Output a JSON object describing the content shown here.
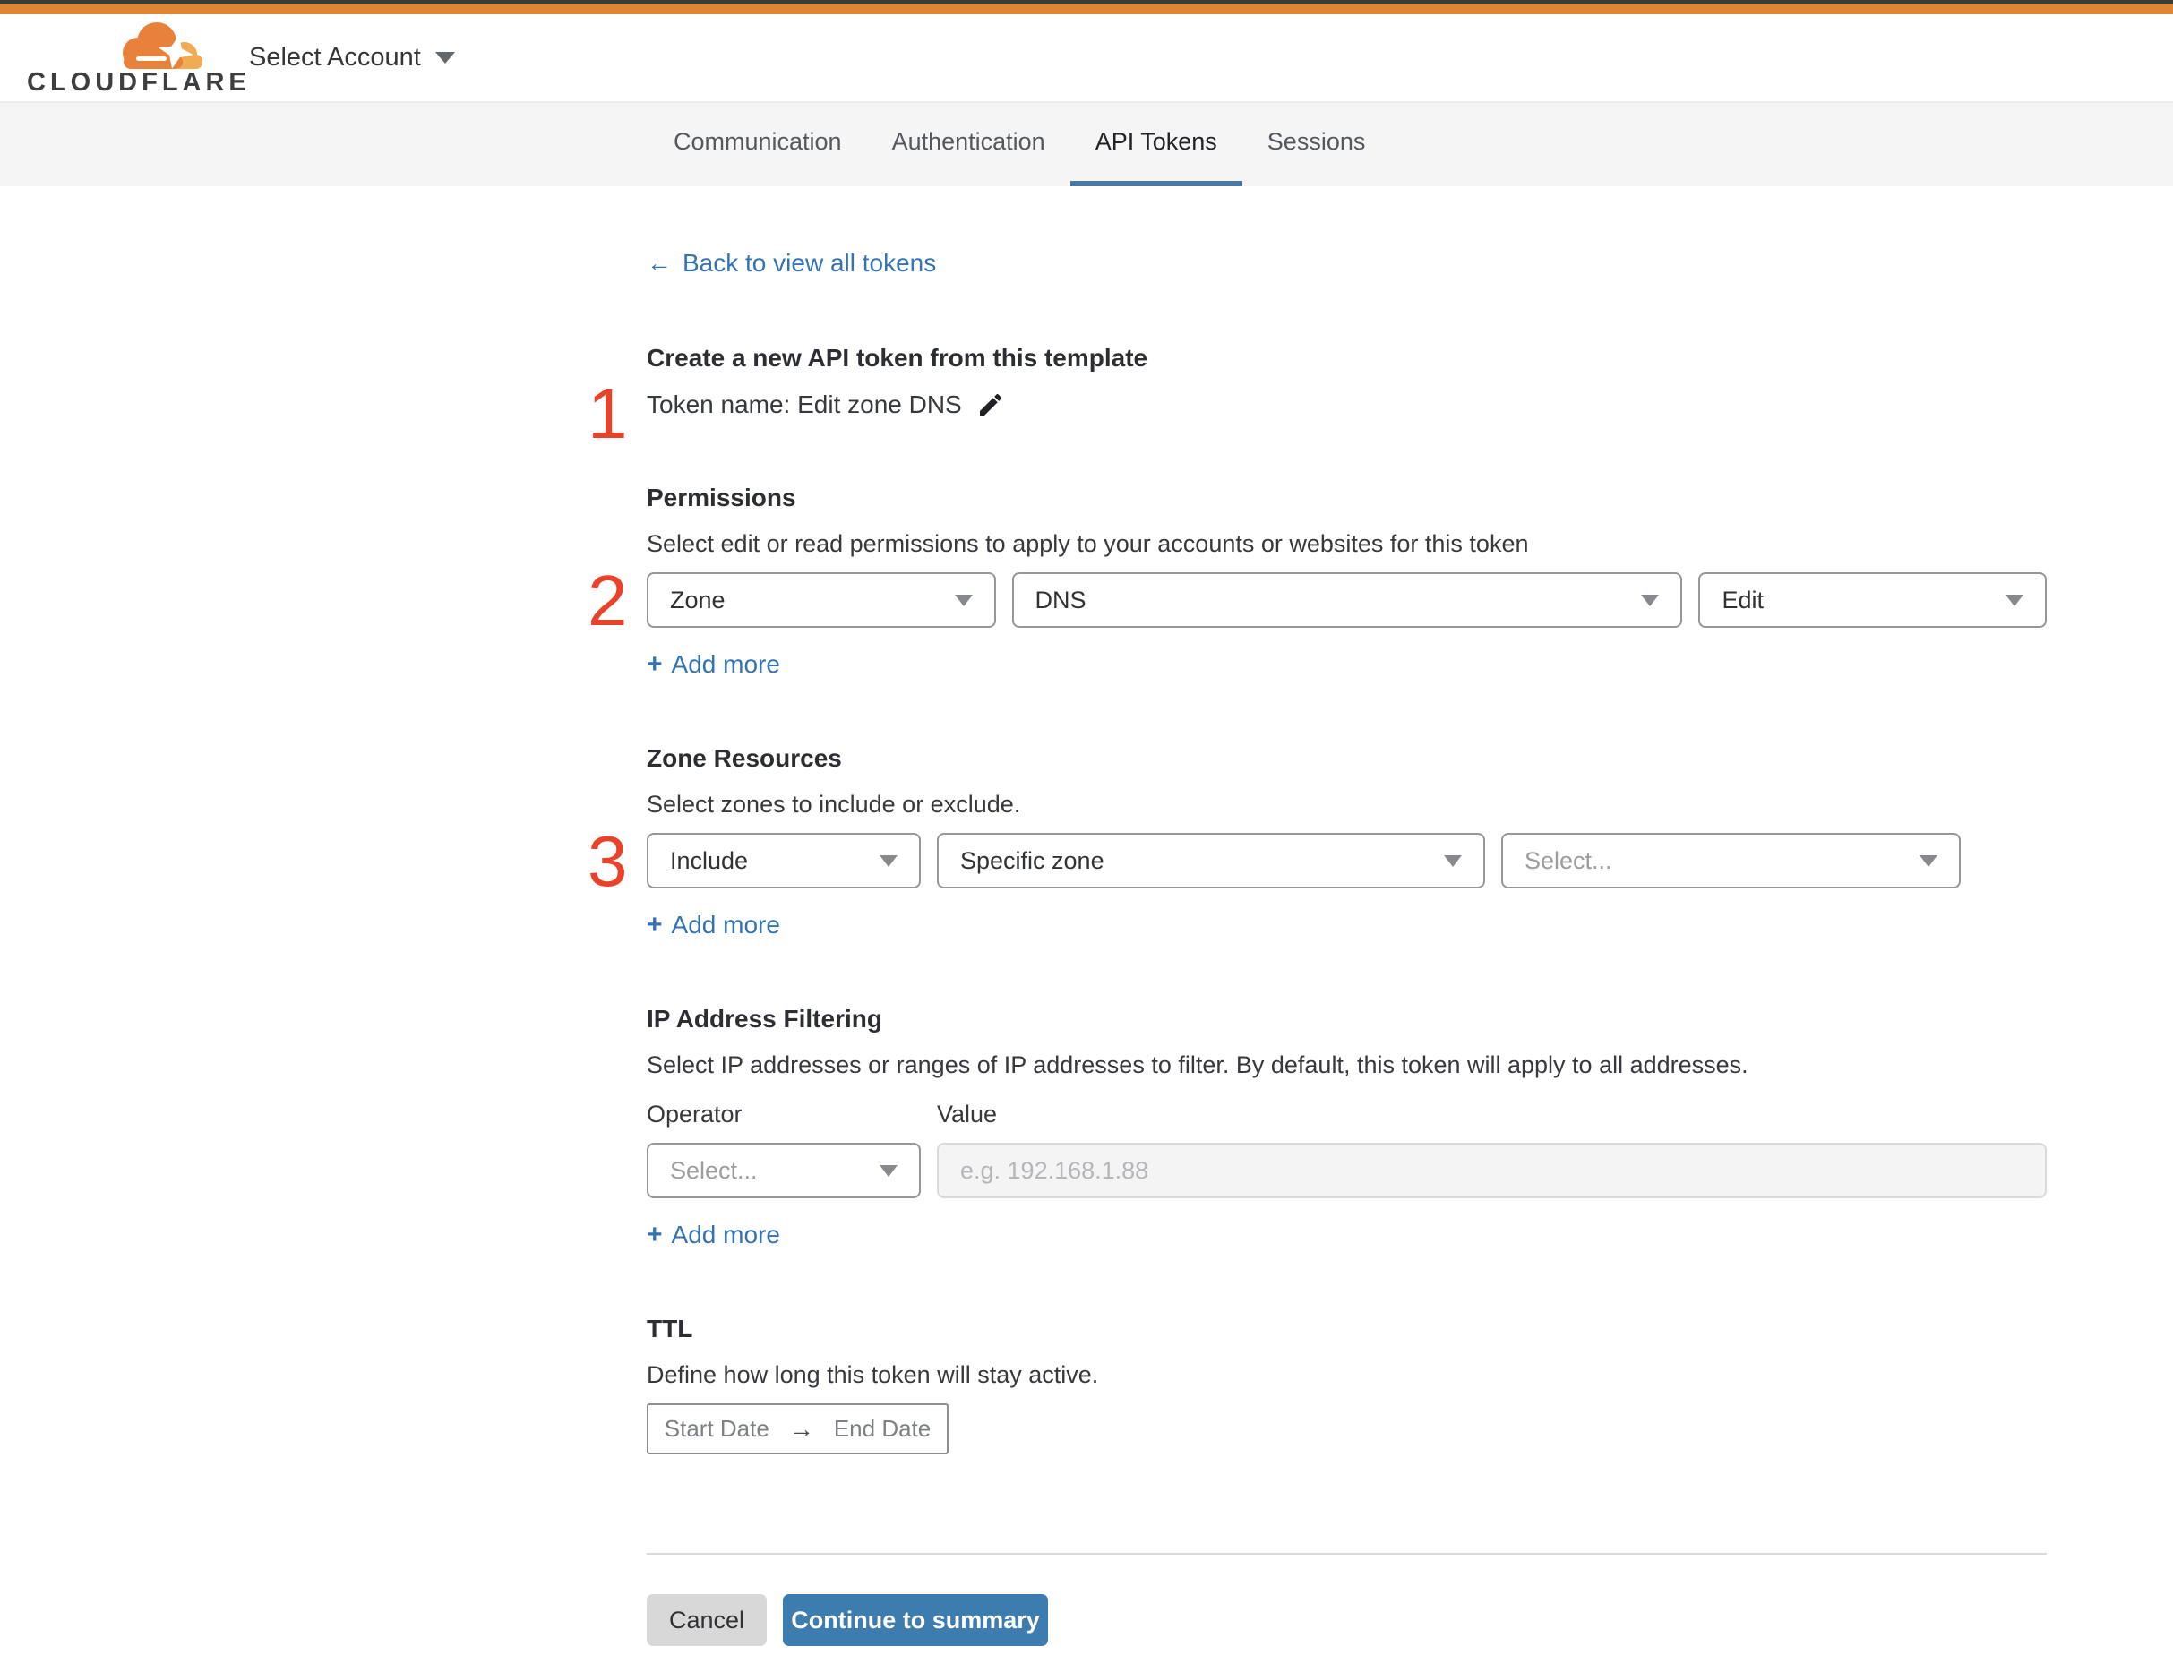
{
  "header": {
    "logo_text": "CLOUDFLARE",
    "account_selector_label": "Select Account"
  },
  "tabs": [
    {
      "label": "Communication"
    },
    {
      "label": "Authentication"
    },
    {
      "label": "API Tokens"
    },
    {
      "label": "Sessions"
    }
  ],
  "active_tab": "API Tokens",
  "back_link": {
    "arrow": "←",
    "label": "Back to view all tokens"
  },
  "step_markers": {
    "token": "1",
    "permissions": "2",
    "zone_resources": "3"
  },
  "token": {
    "heading": "Create a new API token from this template",
    "name_line": "Token name: Edit zone DNS"
  },
  "permissions": {
    "title": "Permissions",
    "description": "Select edit or read permissions to apply to your accounts or websites for this token",
    "scope_value": "Zone",
    "service_value": "DNS",
    "access_value": "Edit",
    "plus": "+",
    "add_more": "Add more"
  },
  "zone_resources": {
    "title": "Zone Resources",
    "description": "Select zones to include or exclude.",
    "operator_value": "Include",
    "type_value": "Specific zone",
    "zone_placeholder": "Select...",
    "plus": "+",
    "add_more": "Add more"
  },
  "ip_filtering": {
    "title": "IP Address Filtering",
    "description": "Select IP addresses or ranges of IP addresses to filter. By default, this token will apply to all addresses.",
    "operator_label": "Operator",
    "value_label": "Value",
    "operator_placeholder": "Select...",
    "value_placeholder": "e.g. 192.168.1.88",
    "plus": "+",
    "add_more": "Add more"
  },
  "ttl": {
    "title": "TTL",
    "description": "Define how long this token will stay active.",
    "start_label": "Start Date",
    "separator": "→",
    "end_label": "End Date"
  },
  "footer": {
    "cancel": "Cancel",
    "continue": "Continue to summary"
  },
  "colors": {
    "accent_orange": "#de8636",
    "link_blue": "#3474b4",
    "button_blue": "#3d7cae",
    "step_red": "#e8432a",
    "tab_underline": "#4679a8"
  }
}
